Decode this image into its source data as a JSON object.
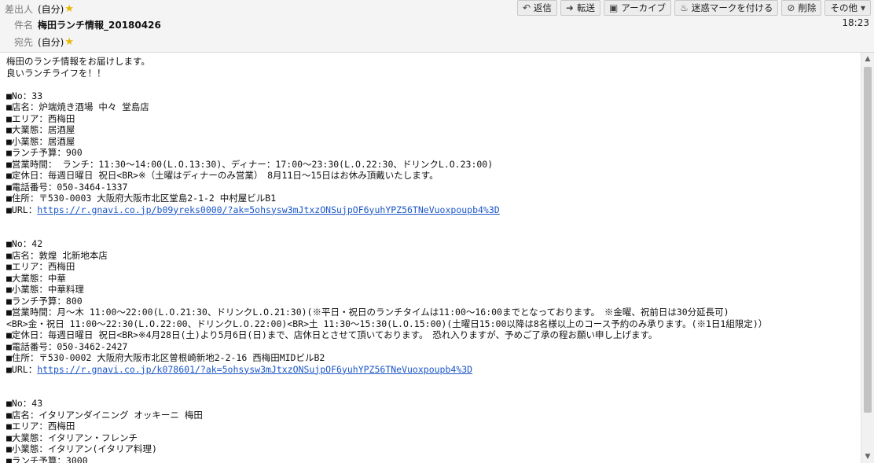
{
  "header": {
    "from_label": "差出人",
    "from_value": "(自分)",
    "subject_label": "件名",
    "subject_value": "梅田ランチ情報_20180426",
    "to_label": "宛先",
    "to_value": "(自分)",
    "time": "18:23"
  },
  "toolbar": {
    "reply": "返信",
    "forward": "転送",
    "archive": "アーカイブ",
    "junk": "迷惑マークを付ける",
    "delete": "削除",
    "more": "その他"
  },
  "body": {
    "intro": [
      "梅田のランチ情報をお届けします。",
      "良いランチライフを！！"
    ],
    "entries": [
      {
        "lines": [
          "■No：33",
          "■店名：炉端焼き酒場 中々 堂島店",
          "■エリア：西梅田",
          "■大業態：居酒屋",
          "■小業態：居酒屋",
          "■ランチ予算：900",
          "■営業時間： ランチ：11:30～14:00(L.O.13:30)、ディナー：17:00～23:30(L.O.22:30、ドリンクL.O.23:00)",
          "■定休日：毎週日曜日 祝日<BR>※（土曜はディナーのみ営業）　8月11日～15日はお休み頂戴いたします。",
          "■電話番号：050-3464-1337",
          "■住所：〒530-0003 大阪府大阪市北区堂島2-1-2 中村屋ビルB1"
        ],
        "url_label": "■URL：",
        "url": "https://r.gnavi.co.jp/b09yreks0000/?ak=5ohsysw3mJtxzONSujpOF6yuhYPZ56TNeVuoxpoupb4%3D"
      },
      {
        "lines": [
          "■No：42",
          "■店名：敦煌 北新地本店",
          "■エリア：西梅田",
          "■大業態：中華",
          "■小業態：中華料理",
          "■ランチ予算：800",
          "■営業時間：月～木 11:00～22:00(L.O.21:30、ドリンクL.O.21:30)(※平日・祝日のランチタイムは11:00～16:00までとなっております。　※金曜、祝前日は30分延長可)",
          "<BR>金・祝日 11:00～22:30(L.O.22:00、ドリンクL.O.22:00)<BR>土 11:30～15:30(L.O.15:00)(土曜日15:00以降は8名様以上のコース予約のみ承ります。(※1日1組限定)）",
          "■定休日：毎週日曜日 祝日<BR>※4月28日(土)より5月6日(日)まで、店休日とさせて頂いております。　恐れ入りますが、予めご了承の程お願い申し上げます。",
          "■電話番号：050-3462-2427",
          "■住所：〒530-0002 大阪府大阪市北区曽根崎新地2-2-16 西梅田MIDビルB2"
        ],
        "url_label": "■URL：",
        "url": "https://r.gnavi.co.jp/k078601/?ak=5ohsysw3mJtxzONSujpOF6yuhYPZ56TNeVuoxpoupb4%3D"
      },
      {
        "lines": [
          "■No：43",
          "■店名：イタリアンダイニング オッキーニ 梅田",
          "■エリア：西梅田",
          "■大業態：イタリアン・フレンチ",
          "■小業態：イタリアン(イタリア料理)",
          "■ランチ予算：3000"
        ],
        "url_label": "",
        "url": ""
      }
    ]
  }
}
